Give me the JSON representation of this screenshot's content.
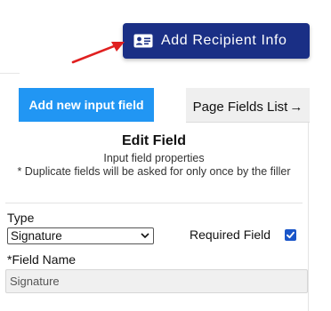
{
  "toolbar": {
    "add_recipient_label": "Add Recipient Info",
    "add_recipient_color": "#1a2f85",
    "add_recipient_icon": "contact-card-icon"
  },
  "annotation": {
    "arrow_color": "#e02020"
  },
  "panel": {
    "add_field_label": "Add new input field",
    "add_field_color": "#2196f3",
    "page_fields_tab_label": "Page Fields List",
    "page_fields_tab_icon": "arrow-right-icon",
    "title": "Edit Field",
    "subtitle": "Input field properties",
    "note": "* Duplicate fields will be asked for only once by the filler"
  },
  "form": {
    "type_label": "Type",
    "type_value": "Signature",
    "required_label": "Required Field",
    "required_checked": true,
    "field_name_label": "*Field Name",
    "field_name_value": "Signature"
  }
}
